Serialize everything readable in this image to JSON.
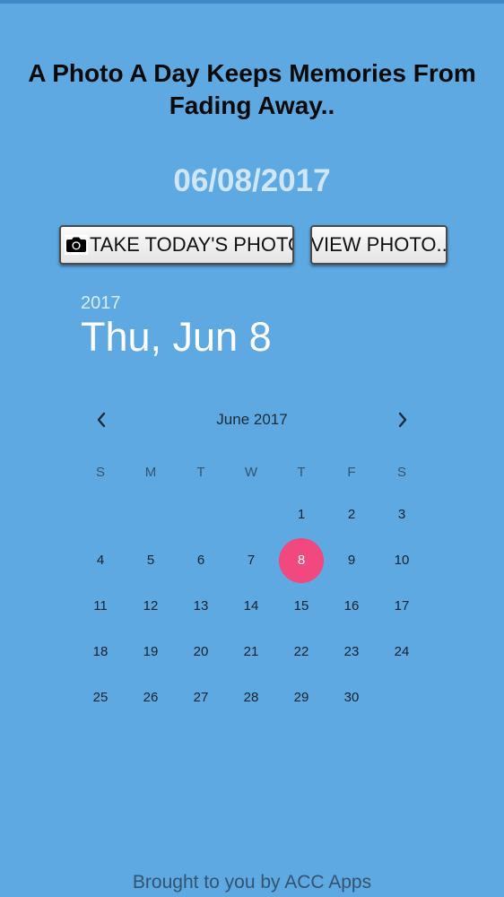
{
  "headline": "A Photo A Day Keeps Memories From Fading Away..",
  "current_date": "06/08/2017",
  "buttons": {
    "take_photo": "TAKE TODAY'S PHOTO",
    "view_photo": "VIEW PHOTO.."
  },
  "icons": {
    "camera": "camera-icon",
    "prev": "chevron-left-icon",
    "next": "chevron-right-icon"
  },
  "picker": {
    "year": "2017",
    "selected_label": "Thu, Jun 8",
    "month_title": "June 2017",
    "weekdays": [
      "S",
      "M",
      "T",
      "W",
      "T",
      "F",
      "S"
    ],
    "weeks": [
      [
        "",
        "",
        "",
        "",
        "1",
        "2",
        "3"
      ],
      [
        "4",
        "5",
        "6",
        "7",
        "8",
        "9",
        "10"
      ],
      [
        "11",
        "12",
        "13",
        "14",
        "15",
        "16",
        "17"
      ],
      [
        "18",
        "19",
        "20",
        "21",
        "22",
        "23",
        "24"
      ],
      [
        "25",
        "26",
        "27",
        "28",
        "29",
        "30",
        ""
      ]
    ],
    "selected_day": "8"
  },
  "footer": "Brought to you by ACC Apps",
  "colors": {
    "background": "#5ea9e2",
    "selected_day": "#f0487f",
    "date_display": "#cfe6f7"
  }
}
